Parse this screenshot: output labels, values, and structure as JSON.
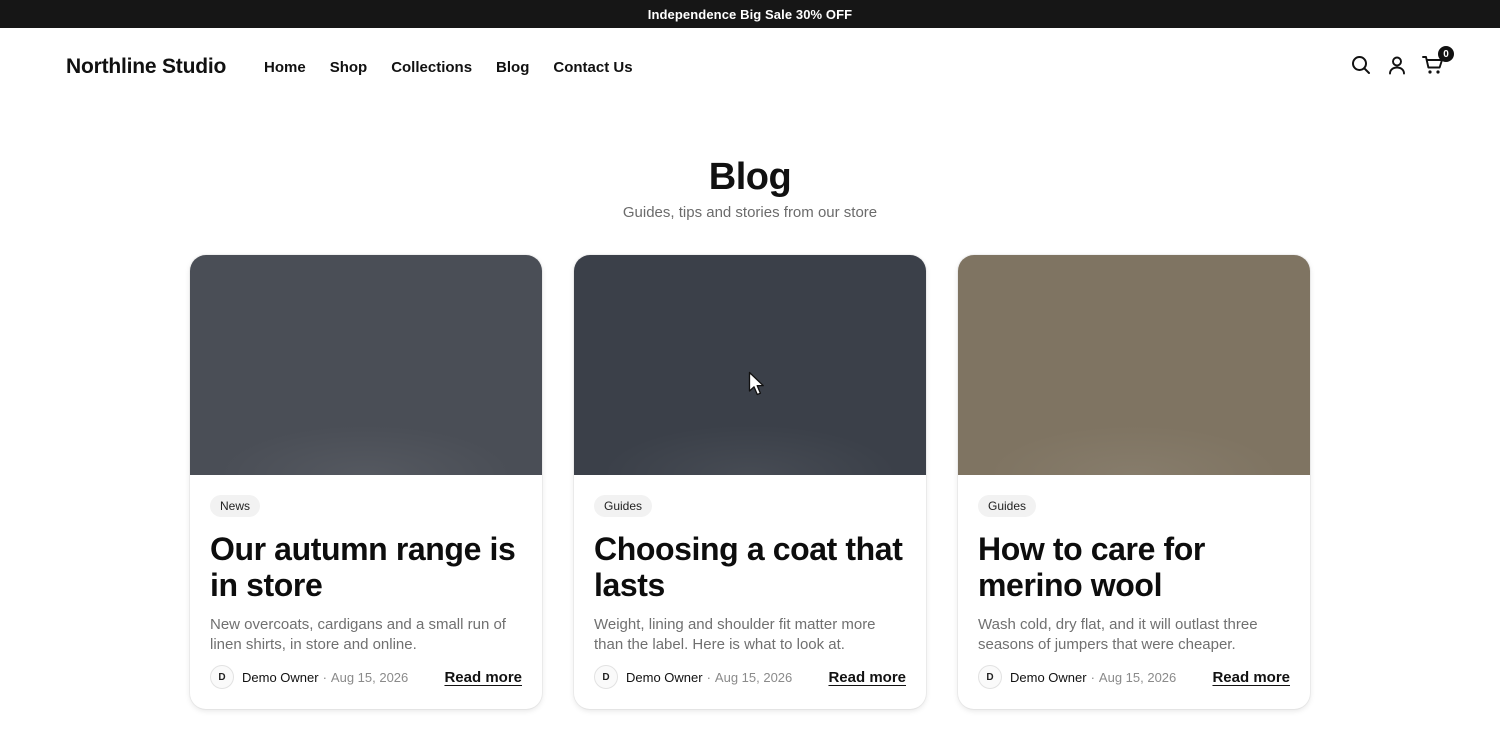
{
  "announcement": {
    "text": "Independence Big Sale 30% OFF"
  },
  "header": {
    "logo": "Northline Studio",
    "nav": [
      "Home",
      "Shop",
      "Collections",
      "Blog",
      "Contact Us"
    ],
    "icons": [
      "search-icon",
      "account-icon",
      "cart-icon"
    ],
    "cart_count": "0"
  },
  "page": {
    "title": "Blog",
    "subtitle": "Guides, tips and stories from our store"
  },
  "posts": [
    {
      "tag": "News",
      "title": "Our autumn range is in store",
      "excerpt": "New overcoats, cardigans and a small run of linen shirts, in store and online.",
      "avatar": "D",
      "author": "Demo Owner",
      "separator": "·",
      "date": "Aug 15, 2026",
      "read_more": "Read more",
      "image_color": "#4a4e56"
    },
    {
      "tag": "Guides",
      "title": "Choosing a coat that lasts",
      "excerpt": "Weight, lining and shoulder fit matter more than the label. Here is what to look at.",
      "avatar": "D",
      "author": "Demo Owner",
      "separator": "·",
      "date": "Aug 15, 2026",
      "read_more": "Read more",
      "image_color": "#3b4049"
    },
    {
      "tag": "Guides",
      "title": "How to care for merino wool",
      "excerpt": "Wash cold, dry flat, and it will outlast three seasons of jumpers that were cheaper.",
      "avatar": "D",
      "author": "Demo Owner",
      "separator": "·",
      "date": "Aug 15, 2026",
      "read_more": "Read more",
      "image_color": "#7f7462"
    }
  ],
  "colors": {
    "announcement_bg": "#161616",
    "text_primary": "#111111",
    "text_muted": "#707070"
  }
}
